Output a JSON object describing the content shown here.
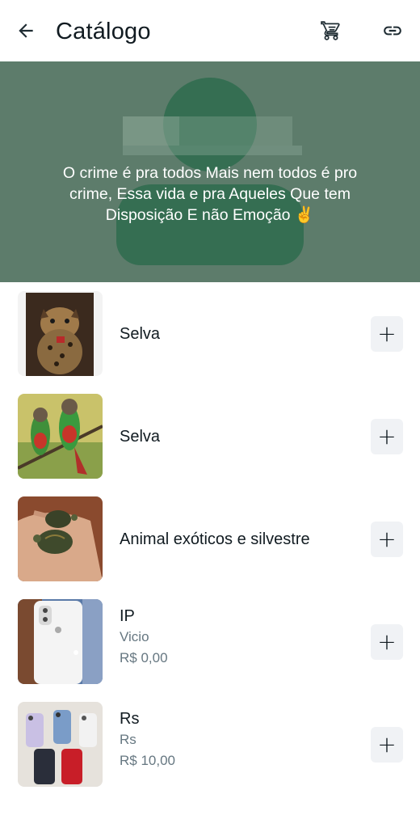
{
  "header": {
    "title": "Catálogo",
    "back_icon": "arrow-left-icon",
    "cart_icon": "cart-icon",
    "link_icon": "link-icon"
  },
  "cover": {
    "description_line1": "O crime é pra todos Mais nem todos é pro",
    "description_line2": "crime, Essa vida e pra Aqueles Que tem",
    "description_line3": "Disposição E não Emoção ✌️",
    "colors": {
      "background": "#5d7c6b",
      "avatar": "#356e52"
    }
  },
  "products": [
    {
      "name": "Selva",
      "description": "",
      "price": "",
      "image": "ocelot-kitten-photo",
      "add_label": "+"
    },
    {
      "name": "Selva",
      "description": "",
      "price": "",
      "image": "green-parakeets-photo",
      "add_label": "+"
    },
    {
      "name": "Animal exóticos e silvestre",
      "description": "",
      "price": "",
      "image": "turtles-in-hand-photo",
      "add_label": "+"
    },
    {
      "name": "IP",
      "description": "Vicio",
      "price": "R$ 0,00",
      "image": "white-iphone-photo",
      "add_label": "+"
    },
    {
      "name": "Rs",
      "description": "Rs",
      "price": "R$ 10,00",
      "image": "iphones-group-photo",
      "add_label": "+"
    }
  ]
}
